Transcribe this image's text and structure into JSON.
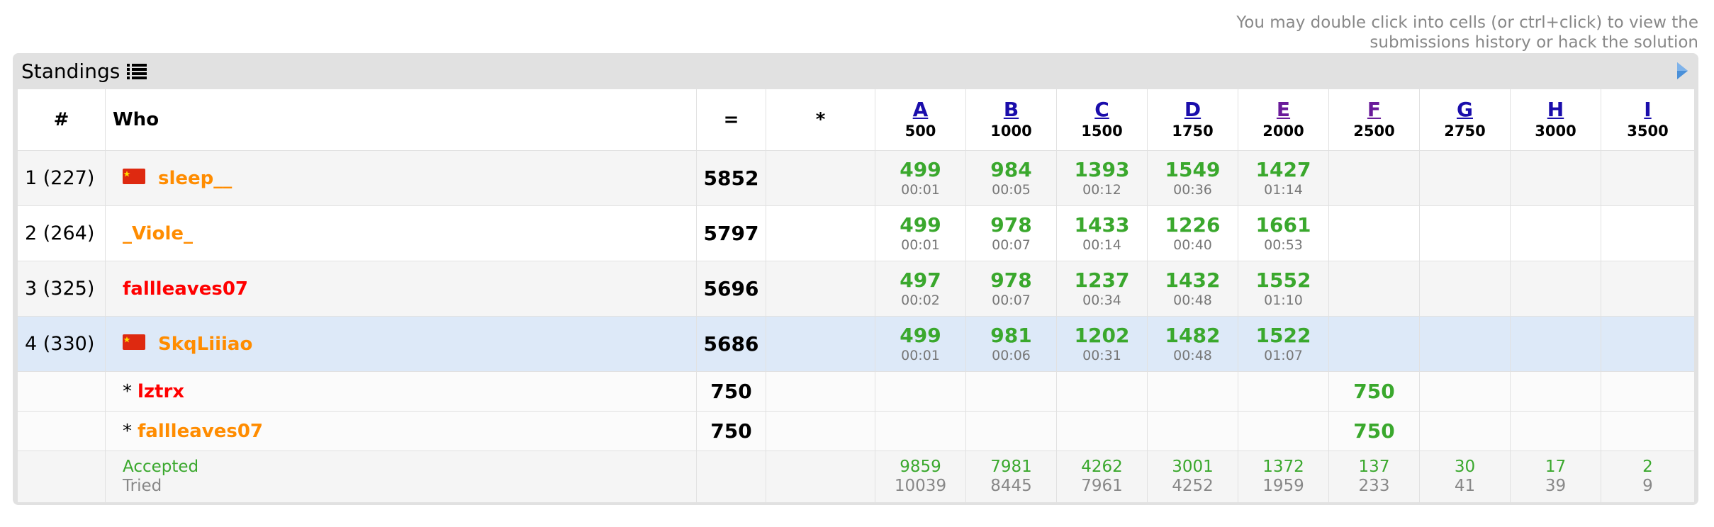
{
  "hint": {
    "line1": "You may double click into cells (or ctrl+click) to view the",
    "line2": "submissions history or hack the solution"
  },
  "panel": {
    "title": "Standings",
    "icons": {
      "list": "list-icon",
      "collapse": "triangle-right-icon"
    }
  },
  "header": {
    "rank": "#",
    "who": "Who",
    "score": "=",
    "penalty": "*",
    "problems": [
      {
        "letter": "A",
        "points": "500"
      },
      {
        "letter": "B",
        "points": "1000"
      },
      {
        "letter": "C",
        "points": "1500"
      },
      {
        "letter": "D",
        "points": "1750"
      },
      {
        "letter": "E",
        "points": "2000"
      },
      {
        "letter": "F",
        "points": "2500"
      },
      {
        "letter": "G",
        "points": "2750"
      },
      {
        "letter": "H",
        "points": "3000"
      },
      {
        "letter": "I",
        "points": "3500"
      }
    ]
  },
  "colors": {
    "accepted": "#3aa82d",
    "user_orange": "#ff8c00",
    "user_red": "#ff0000",
    "highlight": "#dde9f8",
    "link": "#1a0dab"
  },
  "rows": [
    {
      "rank": "1 (227)",
      "flag": "china-flag-icon",
      "handle": "sleep__",
      "color": "orange",
      "score": "5852",
      "results": [
        {
          "pts": "499",
          "time": "00:01"
        },
        {
          "pts": "984",
          "time": "00:05"
        },
        {
          "pts": "1393",
          "time": "00:12"
        },
        {
          "pts": "1549",
          "time": "00:36"
        },
        {
          "pts": "1427",
          "time": "01:14"
        }
      ]
    },
    {
      "rank": "2 (264)",
      "handle": "_Viole_",
      "color": "orange",
      "score": "5797",
      "results": [
        {
          "pts": "499",
          "time": "00:01"
        },
        {
          "pts": "978",
          "time": "00:07"
        },
        {
          "pts": "1433",
          "time": "00:14"
        },
        {
          "pts": "1226",
          "time": "00:40"
        },
        {
          "pts": "1661",
          "time": "00:53"
        }
      ]
    },
    {
      "rank": "3 (325)",
      "handle": "fallleaves07",
      "color": "red",
      "score": "5696",
      "results": [
        {
          "pts": "497",
          "time": "00:02"
        },
        {
          "pts": "978",
          "time": "00:07"
        },
        {
          "pts": "1237",
          "time": "00:34"
        },
        {
          "pts": "1432",
          "time": "00:48"
        },
        {
          "pts": "1552",
          "time": "01:10"
        }
      ]
    },
    {
      "rank": "4 (330)",
      "flag": "china-flag-icon",
      "handle": "SkqLiiiao",
      "color": "orange",
      "score": "5686",
      "results": [
        {
          "pts": "499",
          "time": "00:01"
        },
        {
          "pts": "981",
          "time": "00:06"
        },
        {
          "pts": "1202",
          "time": "00:31"
        },
        {
          "pts": "1482",
          "time": "00:48"
        },
        {
          "pts": "1522",
          "time": "01:07"
        }
      ]
    }
  ],
  "virtual_rows": [
    {
      "prefix": "*",
      "handle": "lztrx",
      "color": "red",
      "score": "750",
      "f_pts": "750"
    },
    {
      "prefix": "*",
      "handle": "fallleaves07",
      "color": "orange",
      "score": "750",
      "f_pts": "750"
    }
  ],
  "stats": {
    "accepted_label": "Accepted",
    "tried_label": "Tried",
    "accepted": [
      "9859",
      "7981",
      "4262",
      "3001",
      "1372",
      "137",
      "30",
      "17",
      "2"
    ],
    "tried": [
      "10039",
      "8445",
      "7961",
      "4252",
      "1959",
      "233",
      "41",
      "39",
      "9"
    ]
  }
}
